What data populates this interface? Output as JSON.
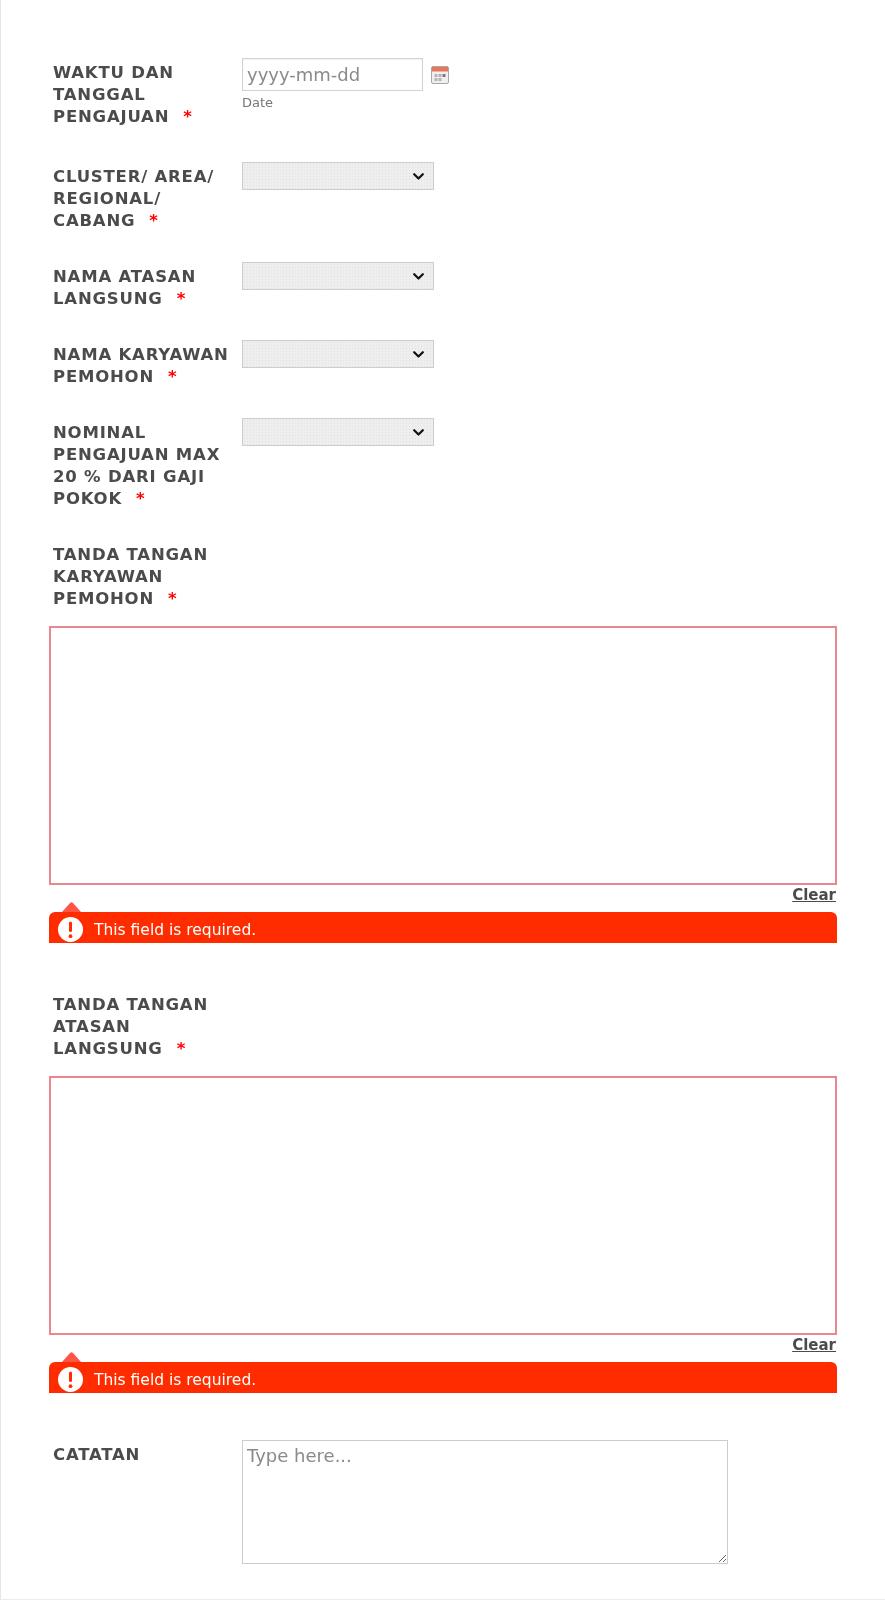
{
  "form": {
    "fields": [
      {
        "kind": "date",
        "label": "WAKTU DAN TANGGAL PENGAJUAN",
        "required_mark": "*",
        "placeholder": "yyyy-mm-dd",
        "sublabel": "Date"
      },
      {
        "kind": "select",
        "label": "CLUSTER/ AREA/ REGIONAL/ CABANG",
        "required_mark": "*"
      },
      {
        "kind": "select",
        "label": "NAMA ATASAN LANGSUNG",
        "required_mark": "*"
      },
      {
        "kind": "select",
        "label": "NAMA KARYAWAN PEMOHON",
        "required_mark": "*"
      },
      {
        "kind": "select",
        "label": "NOMINAL PENGAJUAN MAX 20 % DARI GAJI POKOK",
        "required_mark": "*"
      },
      {
        "kind": "signature",
        "label": "TANDA TANGAN KARYAWAN PEMOHON",
        "required_mark": "*",
        "clear_label": "Clear",
        "error": "This field is required."
      },
      {
        "kind": "signature",
        "label": "TANDA TANGAN ATASAN LANGSUNG",
        "required_mark": "*",
        "clear_label": "Clear",
        "error": "This field is required."
      },
      {
        "kind": "textarea",
        "label": "CATATAN",
        "placeholder": "Type here..."
      }
    ]
  }
}
